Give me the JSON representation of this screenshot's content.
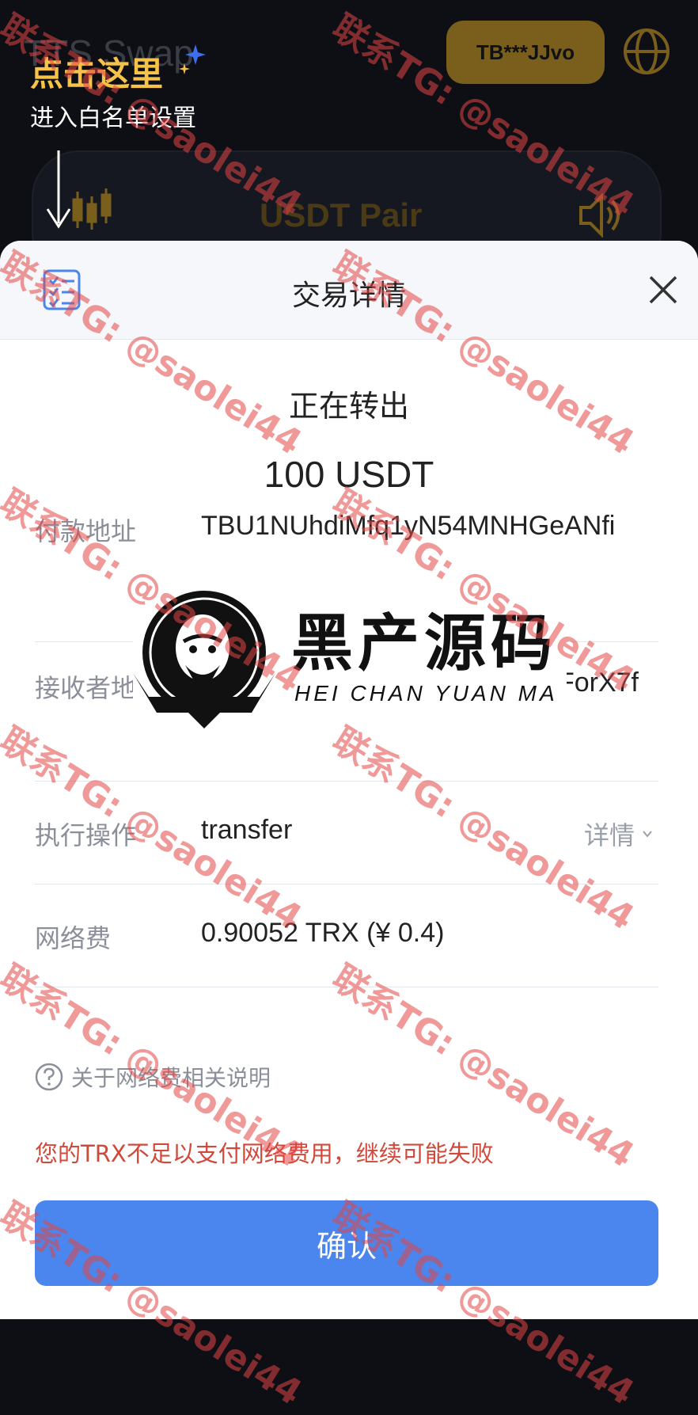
{
  "background_app": {
    "title": "TTS Swap",
    "click_here": "点击这里",
    "whitelist_hint": "进入白名单设置",
    "wallet_label": "TB***JJvo",
    "pair_title": "USDT Pair"
  },
  "sheet": {
    "title": "交易详情",
    "status": "正在转出",
    "amount": "100 USDT",
    "rows": [
      {
        "label": "付款地址",
        "value": "TBU1NUhdiMfq1yN54MNHGeANfi"
      },
      {
        "label": "接收者地址",
        "value": "TC1rCBuXuZWuuYC6RRZgYForX7f7mBKWAf"
      },
      {
        "label": "执行操作",
        "value": "transfer",
        "detail": "详情"
      },
      {
        "label": "网络费",
        "value": "0.90052 TRX (¥ 0.4)"
      }
    ],
    "fee_help": "关于网络费相关说明",
    "warning": "您的TRX不足以支付网络费用，继续可能失败",
    "confirm": "确认"
  },
  "watermark": {
    "text": "联系TG: @saolei44"
  },
  "logo": {
    "cn": "黑产源码",
    "en": "HEI CHAN YUAN MA"
  },
  "colors": {
    "accent_blue": "#4a86ee",
    "warning_red": "#d0493a",
    "gold": "#f6c24a"
  }
}
